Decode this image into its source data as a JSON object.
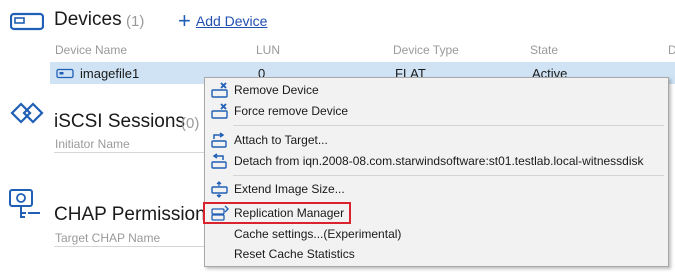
{
  "devices": {
    "title": "Devices",
    "count": "(1)",
    "add_label": "Add Device",
    "columns": [
      "Device Name",
      "LUN",
      "Device Type",
      "State",
      "D"
    ],
    "row": {
      "name": "imagefile1",
      "lun": "0",
      "type": "FLAT",
      "state": "Active"
    }
  },
  "iscsi": {
    "title": "iSCSI Sessions",
    "count": "(0)",
    "column": "Initiator Name"
  },
  "chap": {
    "title": "CHAP Permission",
    "column": "Target CHAP Name"
  },
  "context_menu": {
    "items": [
      "Remove Device",
      "Force remove Device",
      "Attach to Target...",
      "Detach from iqn.2008-08.com.starwindsoftware:st01.testlab.local-witnessdisk",
      "Extend Image Size...",
      "Replication Manager",
      "Cache settings...(Experimental)",
      "Reset Cache Statistics"
    ]
  },
  "colors": {
    "selection": "#cfe3f5",
    "accent_blue": "#1f5fb5",
    "highlight_red": "#d9232d"
  }
}
